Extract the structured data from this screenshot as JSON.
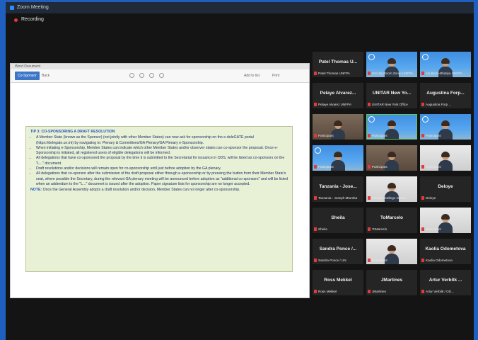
{
  "window": {
    "title": "Zoom Meeting"
  },
  "recording": {
    "label": "Recording"
  },
  "share_window": {
    "title": "Word Document",
    "toolbar": {
      "primary_button": "Co-Sponsor",
      "secondary_button": "Back",
      "right_button_1": "Add to list",
      "right_button_2": "Print"
    }
  },
  "tip": {
    "heading": "TIP 3: CO-SPONSORING A DRAFT RESOLUTION",
    "items": [
      "A Member State (known as the Sponsor) (not jointly with other Member States) can now ask for sponsorship on the e-deleGATE portal (https://delegate.un.int) by navigating to: Plenary & Committees/GA Plenary/GA Plenary e-Sponsorship.",
      "When initiating e-Sponsorship, Member States can indicate which other Member States and/or observer states can co-sponsor the proposal. Once e-Sponsorship is initiated, all registered users of eligible delegations will be informed.",
      "All delegations that have co-sponsored the proposal by the time it is submitted to the Secretariat for issuance in ODS, will be listed as co-sponsors on the \"L...\" document.",
      "Draft resolutions and/or decisions will remain open for co-sponsorship until just before adoption by the GA plenary.",
      "All delegations that co-sponsor after the submission of the draft proposal either through e-sponsorship or by pressing the button from their Member State's seat, where possible the Secretary, during the relevant GA plenary meeting will be announced before adoption as \"additional co-sponsors\" and will be listed when an addendum to the \"L...\" document is issued after the adoption. Paper signature lists for sponsorship are no longer accepted."
    ],
    "note_label": "NOTE:",
    "note_text": "Once the General Assembly adopts a draft resolution and/or decision, Member States can no longer alter co-sponsorship."
  },
  "participants": [
    {
      "name": "Patel Thomas U...",
      "label": "Patel Thomas UNFPA",
      "video": false
    },
    {
      "name": "",
      "label": "UN HQ-Room Zoom UNFPA",
      "video": true,
      "scene": "blue"
    },
    {
      "name": "",
      "label": "Ida Berry-Bhatiya UNFPA",
      "video": true,
      "scene": "blue"
    },
    {
      "name": "Pelaye Alvarez...",
      "label": "Pelaye Alvarez UNFPA",
      "video": false
    },
    {
      "name": "UNITAR New Yo...",
      "label": "UNITAR New York Office",
      "video": false
    },
    {
      "name": "Augustina Forp...",
      "label": "Augustina Forp ...",
      "video": false
    },
    {
      "name": "",
      "label": "Participant",
      "video": true,
      "scene": "room"
    },
    {
      "name": "",
      "label": "Participant",
      "video": true,
      "scene": "blue",
      "active": true
    },
    {
      "name": "",
      "label": "Participant",
      "video": true,
      "scene": "blue"
    },
    {
      "name": "",
      "label": "Participant",
      "video": true,
      "scene": "blue"
    },
    {
      "name": "",
      "label": "Participant",
      "video": true,
      "scene": "room"
    },
    {
      "name": "",
      "label": "Participant",
      "video": true,
      "scene": "white"
    },
    {
      "name": "Tanzania - Jose...",
      "label": "Tanzania - Joseph Mtumba",
      "video": false
    },
    {
      "name": "",
      "label": "Maxime Gallego Garcia",
      "video": true,
      "scene": "white"
    },
    {
      "name": "Deloye",
      "label": "Deloye",
      "video": false
    },
    {
      "name": "Sheila",
      "label": "Sheila",
      "video": false
    },
    {
      "name": "ToMarcelo",
      "label": "ToMarcelo",
      "video": false
    },
    {
      "name": "",
      "label": "Participant",
      "video": true,
      "scene": "white"
    },
    {
      "name": "Sandra Ponce /...",
      "label": "Sandra Ponce / UN",
      "video": false
    },
    {
      "name": "",
      "label": "Participant",
      "video": true,
      "scene": "white"
    },
    {
      "name": "Kaolia Odometova",
      "label": "Kaolia Odometova",
      "video": false
    },
    {
      "name": "Ross Mekkel",
      "label": "Ross Mekkel",
      "video": false
    },
    {
      "name": "JMartines",
      "label": "JMartines",
      "video": false
    },
    {
      "name": "Artur Verbitk ...",
      "label": "Artur Verbitk / OD...",
      "video": false
    }
  ]
}
